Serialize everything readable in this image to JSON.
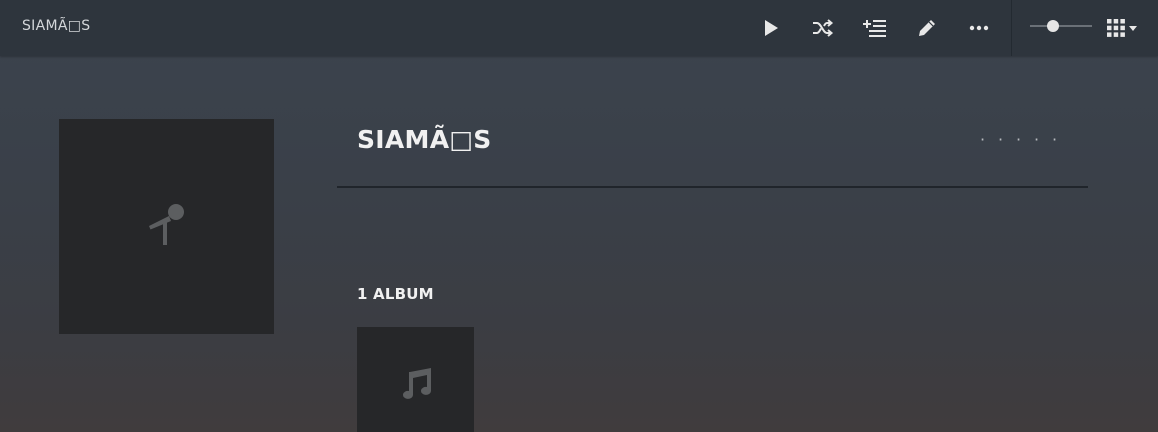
{
  "header": {
    "title": "SIAMÃ□S"
  },
  "toolbar": {
    "buttons": [
      {
        "name": "play-button",
        "icon": "play-icon"
      },
      {
        "name": "shuffle-button",
        "icon": "shuffle-icon"
      },
      {
        "name": "add-to-queue-button",
        "icon": "add-queue-icon"
      },
      {
        "name": "edit-button",
        "icon": "pencil-icon"
      },
      {
        "name": "more-button",
        "icon": "ellipsis-icon"
      }
    ],
    "size_slider_level": 0.33,
    "view_mode_icon": "grid-icon"
  },
  "artist": {
    "name": "SIAMÃ□S",
    "placeholder_icon": "microphone-icon",
    "rating": {
      "stars": 0,
      "max": 5,
      "empty_glyph": "·"
    }
  },
  "albums_section": {
    "header": "1 ALBUM",
    "albums": [
      {
        "placeholder_icon": "music-note-icon"
      }
    ]
  },
  "colors": {
    "topbar": "#2e353d",
    "placeholder_bg": "#262729",
    "text": "#f1f1f1"
  }
}
